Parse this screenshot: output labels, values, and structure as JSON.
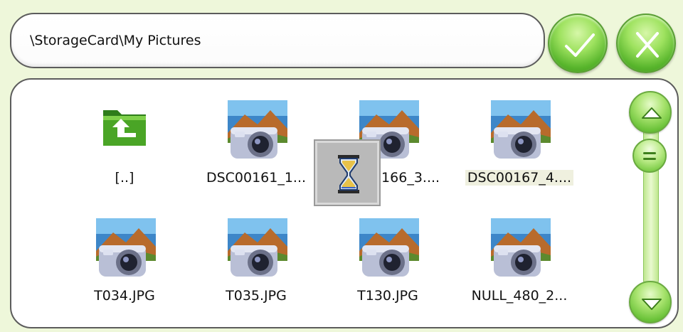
{
  "path": {
    "text": "\\StorageCard\\My Pictures"
  },
  "actions": {
    "confirm_icon": "checkmark-icon",
    "cancel_icon": "close-icon"
  },
  "files": [
    {
      "label": "[..]",
      "icon": "folder-up-icon"
    },
    {
      "label": "DSC00161_1...",
      "icon": "camera-photo-icon"
    },
    {
      "label": "DSC00166_3....",
      "icon": "camera-photo-icon"
    },
    {
      "label": "DSC00167_4....",
      "icon": "camera-photo-icon",
      "selected": true
    },
    {
      "label": "T034.JPG",
      "icon": "camera-photo-icon"
    },
    {
      "label": "T035.JPG",
      "icon": "camera-photo-icon"
    },
    {
      "label": "T130.JPG",
      "icon": "camera-photo-icon"
    },
    {
      "label": "NULL_480_2...",
      "icon": "camera-photo-icon"
    }
  ],
  "scrollbar": {
    "up_icon": "arrow-up-icon",
    "down_icon": "arrow-down-icon",
    "thumb_icon": "grip-icon"
  },
  "busy": {
    "icon": "hourglass-icon"
  },
  "colors": {
    "background": "#eef7da",
    "accent_green": "#6cc33a",
    "selection": "#eff0df"
  }
}
